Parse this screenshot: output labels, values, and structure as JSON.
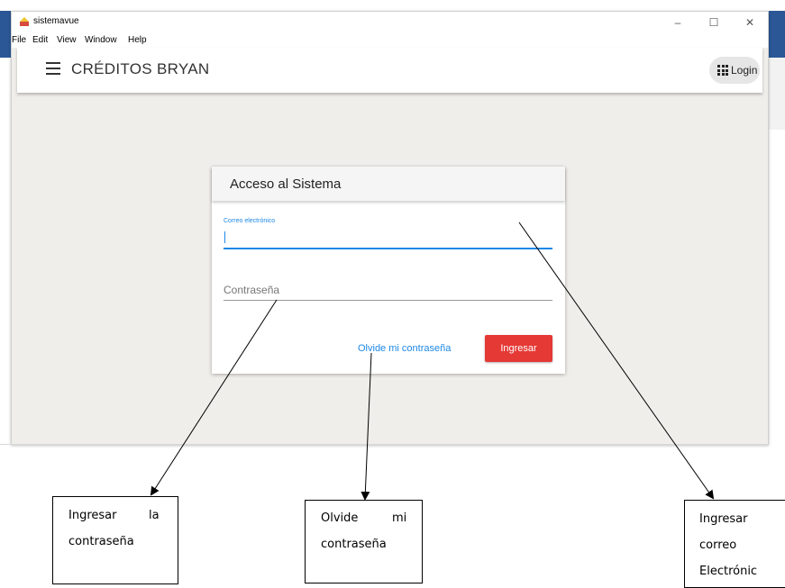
{
  "window": {
    "title": "sistemavue",
    "controls": {
      "minimize": "–",
      "maximize": "☐",
      "close": "✕"
    }
  },
  "menu": {
    "file": "File",
    "edit": "Edit",
    "view": "View",
    "window": "Window",
    "help": "Help"
  },
  "toolbar": {
    "app_name": "CRÉDITOS BRYAN",
    "login_label": "Login"
  },
  "login_card": {
    "title": "Acceso al Sistema",
    "email_label": "Correo electrónico",
    "email_value": "",
    "password_placeholder": "Contraseña",
    "forgot_link": "Olvide mi contraseña",
    "submit_label": "Ingresar"
  },
  "annotations": {
    "password": {
      "line1_left": "Ingresar",
      "line1_right": "la",
      "line2": "contraseña"
    },
    "forgot": {
      "line1_left": "Olvide",
      "line1_right": "mi",
      "line2": "contraseña"
    },
    "email": {
      "line1": "Ingresar",
      "line2": "correo",
      "line3": "Electrónic"
    }
  },
  "colors": {
    "accent": "#1e88e5",
    "button": "#e53935",
    "background": "#f0eeea"
  }
}
